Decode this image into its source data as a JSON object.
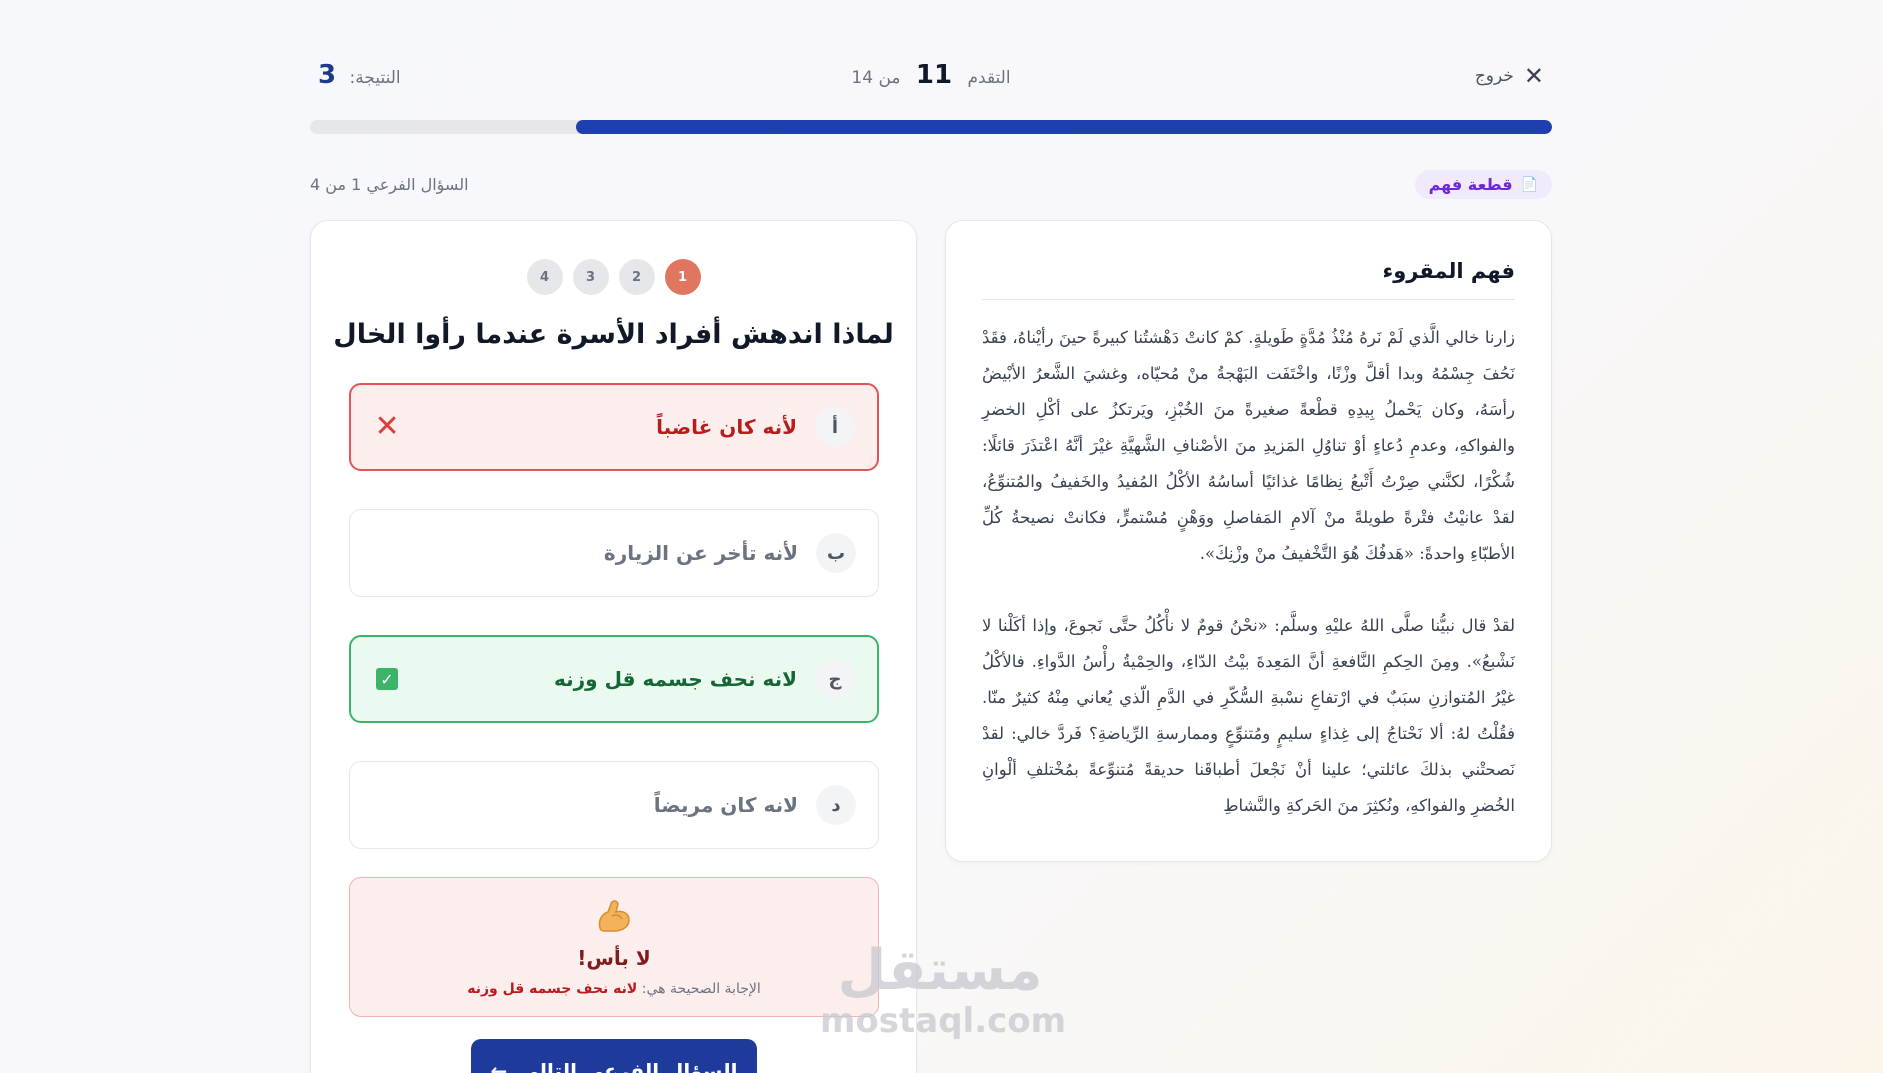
{
  "header": {
    "exit_label": "خروج",
    "progress_label": "التقدم",
    "progress_current": "11",
    "progress_of": "من 14",
    "score_label": "النتيجة:",
    "score_value": "3",
    "progress_fraction": 0.786
  },
  "badge": {
    "label": "قطعة فهم",
    "icon": "document-icon"
  },
  "subquestion_label": "السؤال الفرعي 1 من 4",
  "reading": {
    "title": "فهم المقروء",
    "paragraph_1": "زارنا خالي الَّذي لَمْ نَرهُ مُنْذُ مُدَّةٍ طَويلةٍ. كمْ كانتْ دَهْشتُنا كبيرةً حينَ رأيْناهُ، فقَدْ نَحُفَ جِسْمُهُ وبدا أقلَّ وزْنًا، واخْتَفَت البَهْجةُ منْ مُحيّاه، وغشيَ الشَّعرُ الأبْيضُ رأسَهُ، وكان يَحْملُ بِيدِهِ قطْعةً صغيرةً منَ الخُبْزِ، ويَرتكزُ على أكْلِ الخضرِ والفواكهِ، وعدمِ دُعاءٍ أوْ تناوُلِ المَزيدِ منَ الأصْنافِ الشَّهيَّةِ غيْرَ أنَّهُ اعْتذَرَ قائلًا: شُكْرًا، لكنَّني صِرْتُ أَتْبعُ نِظامًا غذائيًا أساسُهُ الأكْلُ المُفيدُ والخَفيفُ والمُتنوِّعُ، لقدْ عانيْتُ فتْرةً طويلةً منْ آلامِ المَفاصلِ ووَهْنٍ مُسْتمرٍّ، فكانتْ نصيحةُ كُلِّ الأطبّاءِ واحدةً: «هَدفُكَ هُوَ التَّخْفيفُ منْ وزْنِكَ».",
    "paragraph_2": "لقدْ قال نبيُّنا صلَّى اللهُ عليْهِ وسلَّم: «نحْنُ قومٌ لا نأْكُلُ حتَّى نَجوعَ، وإذا أكَلْنا لا نَشْبعُ». ومِنَ الحِكمِ النَّافعةِ أنَّ المَعِدةَ بيْتُ الدّاءِ، والحِمْيةُ رأْسُ الدَّواءِ. فالأكْلُ غيْرُ المُتوازنِ سبَبٌ في ارْتفاعِ نسْبةِ السُّكّرِ في الدَّمِ الّذي يُعاني مِنْهُ كثيرٌ منّا. فقُلْتُ لهُ: ألا نَحْتاجُ إلى غِذاءٍ سليمٍ ومُتنوِّعٍ وممارسةِ الرِّياضةِ؟ فَردَّ خالي: لقدْ نَصحتْني بذلكَ عائلتي؛ علينا أنْ نَجْعلَ أطباقَنا حديقةً مُتنوِّعةً بمُخْتلفِ ألْوانِ الخُضرِ والفواكهِ، ونُكثِرَ منَ الحَركةِ والنَّشاطِ"
  },
  "question": {
    "steps": [
      "1",
      "2",
      "3",
      "4"
    ],
    "active_step": 1,
    "title": "لماذا اندهش أفراد الأسرة عندما رأوا الخال",
    "options": [
      {
        "letter": "أ",
        "text": "لأنه كان غاضباً",
        "state": "wrong"
      },
      {
        "letter": "ب",
        "text": "لأنه تأخر عن الزيارة",
        "state": "neutral"
      },
      {
        "letter": "ج",
        "text": "لانه نحف جسمه قل وزنه",
        "state": "correct"
      },
      {
        "letter": "د",
        "text": "لانه كان مريضاً",
        "state": "neutral"
      }
    ]
  },
  "feedback": {
    "icon": "flexed-biceps-icon",
    "heading": "لا بأس!",
    "answer_prefix": "الإجابة الصحيحة هي:",
    "answer_value": "لانه نحف جسمه قل وزنه"
  },
  "next_button": {
    "label": "السؤال الفرعي التالي",
    "icon": "arrow-left-icon"
  },
  "watermark": {
    "arabic": "مستقل",
    "latin": "mostaql.com"
  },
  "colors": {
    "primary": "#1e40af",
    "step_active": "#e07560",
    "wrong": "#e05555",
    "correct": "#3bb46a",
    "badge_text": "#6d28d9"
  }
}
